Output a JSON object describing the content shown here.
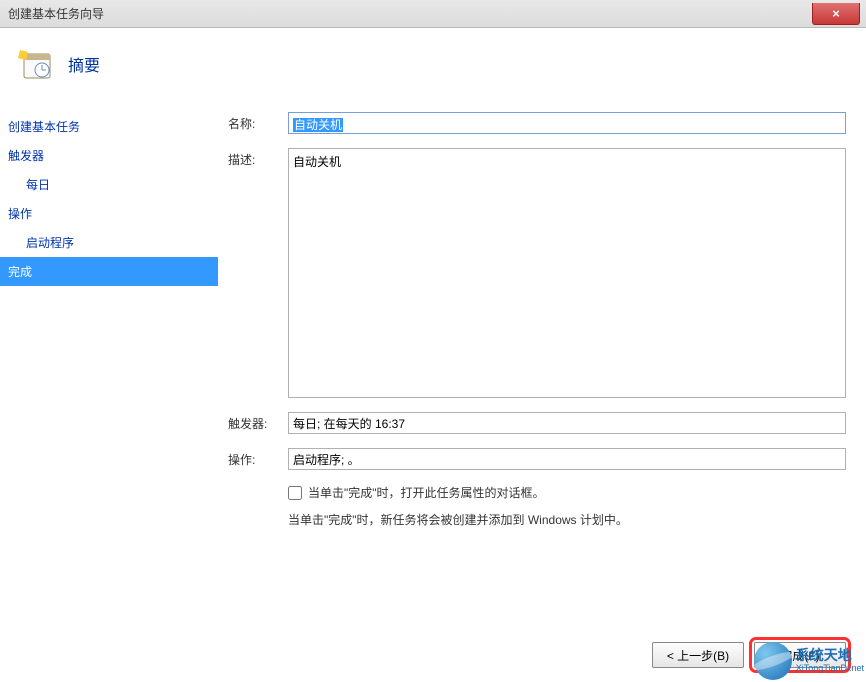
{
  "window": {
    "title": "创建基本任务向导",
    "close_label": "×"
  },
  "header": {
    "title": "摘要"
  },
  "sidebar": {
    "items": [
      {
        "label": "创建基本任务",
        "indent": false,
        "active": false
      },
      {
        "label": "触发器",
        "indent": false,
        "active": false
      },
      {
        "label": "每日",
        "indent": true,
        "active": false
      },
      {
        "label": "操作",
        "indent": false,
        "active": false
      },
      {
        "label": "启动程序",
        "indent": true,
        "active": false
      },
      {
        "label": "完成",
        "indent": false,
        "active": true
      }
    ]
  },
  "form": {
    "name_label": "名称:",
    "name_value": "自动关机",
    "desc_label": "描述:",
    "desc_value": "自动关机",
    "trigger_label": "触发器:",
    "trigger_value": "每日; 在每天的 16:37",
    "action_label": "操作:",
    "action_value": "启动程序; 。",
    "checkbox_label": "当单击\"完成\"时，打开此任务属性的对话框。",
    "note": "当单击\"完成\"时，新任务将会被创建并添加到 Windows 计划中。"
  },
  "footer": {
    "back_label": "< 上一步(B)",
    "finish_label": "完成(F)"
  },
  "watermark": {
    "cn": "系统天地",
    "en": "XiTongTianDi.net"
  }
}
